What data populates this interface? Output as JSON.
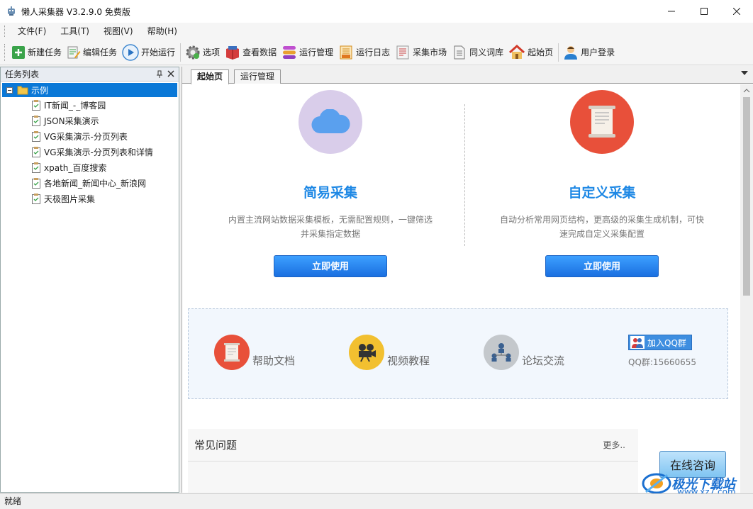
{
  "window": {
    "title": "懒人采集器 V3.2.9.0 免费版"
  },
  "menu": [
    "文件(F)",
    "工具(T)",
    "视图(V)",
    "帮助(H)"
  ],
  "toolbar": {
    "new_task": "新建任务",
    "edit_task": "编辑任务",
    "start_run": "开始运行",
    "options": "选项",
    "view_data": "查看数据",
    "run_manage": "运行管理",
    "run_log": "运行日志",
    "market": "采集市场",
    "synonyms": "同义词库",
    "home": "起始页",
    "login": "用户登录"
  },
  "task_panel": {
    "title": "任务列表",
    "root": "示例",
    "items": [
      "IT新闻_-_博客园",
      "JSON采集演示",
      "VG采集演示-分页列表",
      "VG采集演示-分页列表和详情",
      "xpath_百度搜索",
      "各地新闻_新闻中心_新浪网",
      "天极图片采集"
    ]
  },
  "tabs": [
    "起始页",
    "运行管理"
  ],
  "start_page": {
    "simple": {
      "title": "简易采集",
      "desc": "内置主流网站数据采集模板，无需配置规则，一键筛选并采集指定数据",
      "button": "立即使用"
    },
    "custom": {
      "title": "自定义采集",
      "desc": "自动分析常用网页结构，更高级的采集生成机制，可快速完成自定义采集配置",
      "button": "立即使用"
    },
    "links": {
      "help": "帮助文档",
      "video": "视频教程",
      "forum": "论坛交流",
      "qq_button": "加入QQ群",
      "qq_number": "QQ群:15660655"
    },
    "faq": {
      "title": "常见问题",
      "more": "更多.."
    },
    "consult": "在线咨询"
  },
  "watermark": {
    "text": "极光下载站",
    "url": "www.xz7.com"
  },
  "status": "就绪",
  "colors": {
    "accent": "#1e88e5",
    "selected": "#0a78d7",
    "simple_circle": "#d9cdea",
    "custom_circle": "#e8503a"
  }
}
